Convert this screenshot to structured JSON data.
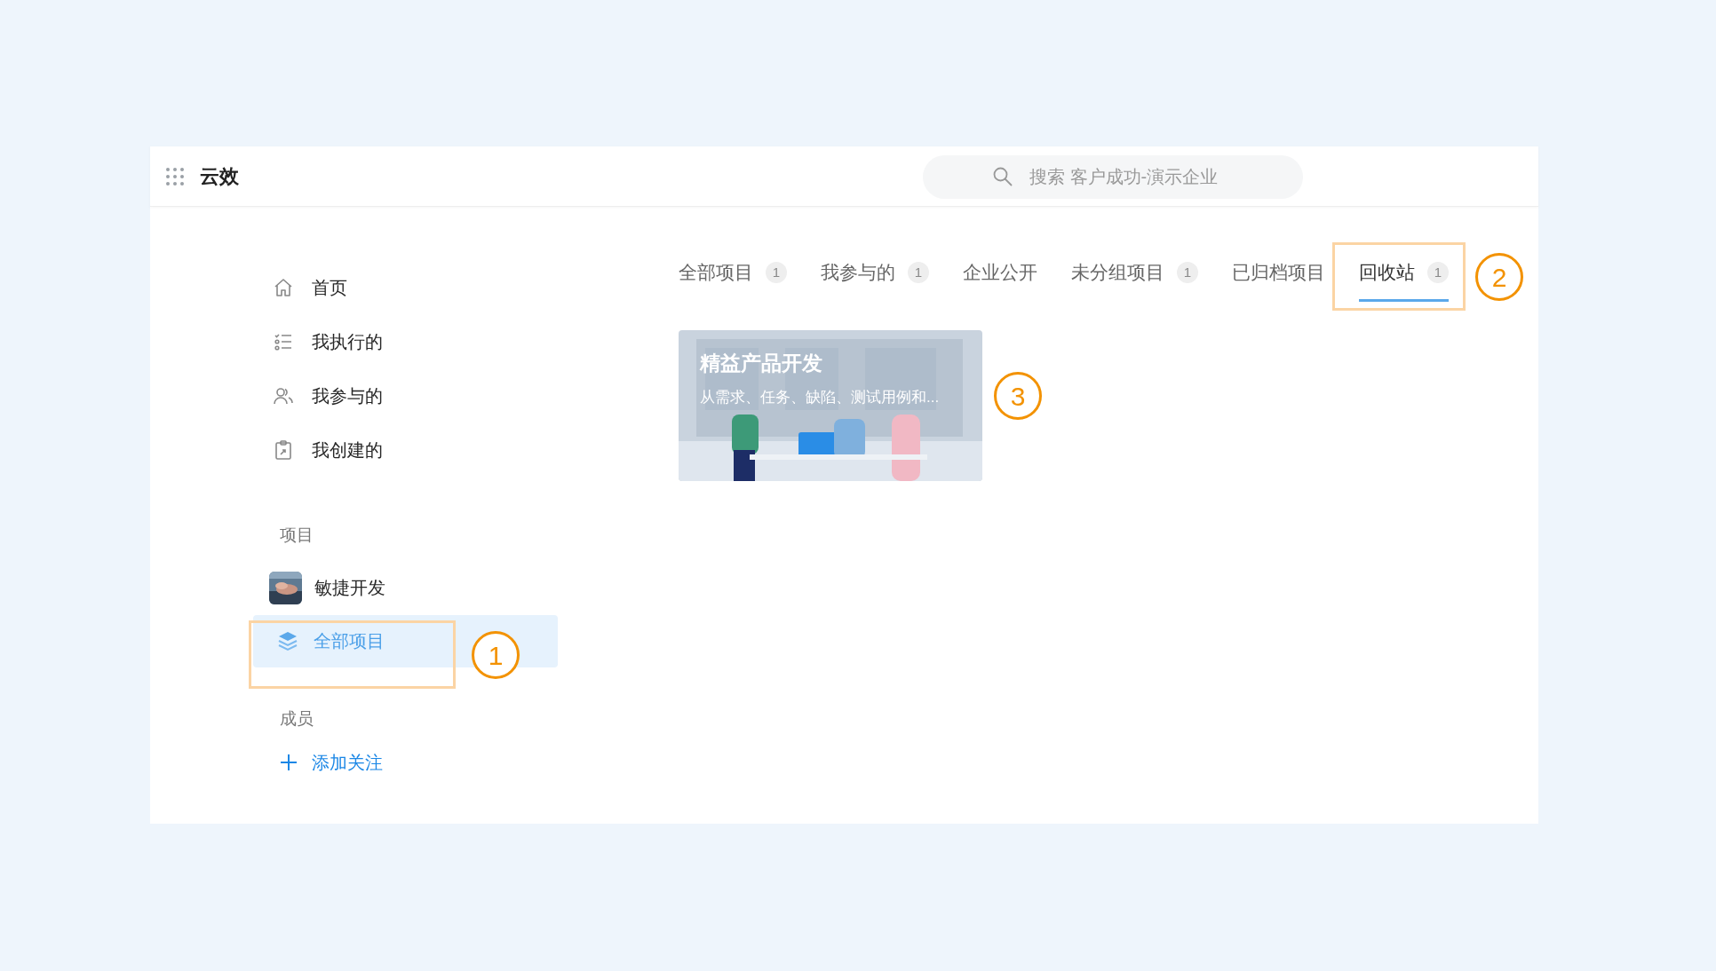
{
  "header": {
    "app_name": "云效",
    "search": {
      "placeholder": "搜索 客户成功-演示企业"
    }
  },
  "sidebar": {
    "items": [
      {
        "kind": "home",
        "label": "首页",
        "selected": false
      },
      {
        "kind": "list",
        "label": "我执行的",
        "selected": false
      },
      {
        "kind": "people",
        "label": "我参与的",
        "selected": false
      },
      {
        "kind": "clipboard",
        "label": "我创建的",
        "selected": false
      }
    ],
    "projects_heading": "项目",
    "projects": [
      {
        "kind": "avatar",
        "label": "敏捷开发",
        "selected": false
      },
      {
        "kind": "layers",
        "label": "全部项目",
        "selected": true
      }
    ],
    "members_heading": "成员",
    "add_follow": {
      "label": "添加关注"
    }
  },
  "tabs": [
    {
      "label": "全部项目",
      "count": "1",
      "selected": false
    },
    {
      "label": "我参与的",
      "count": "1",
      "selected": false
    },
    {
      "label": "企业公开",
      "selected": false
    },
    {
      "label": "未分组项目",
      "count": "1",
      "selected": false
    },
    {
      "label": "已归档项目",
      "selected": false
    },
    {
      "label": "回收站",
      "count": "1",
      "selected": true
    }
  ],
  "project_cards": [
    {
      "kind": "picture",
      "title": "精益产品开发",
      "description": "从需求、任务、缺陷、测试用例和..."
    }
  ],
  "annotations": [
    {
      "label": "1"
    },
    {
      "label": "2"
    },
    {
      "label": "3"
    }
  ]
}
